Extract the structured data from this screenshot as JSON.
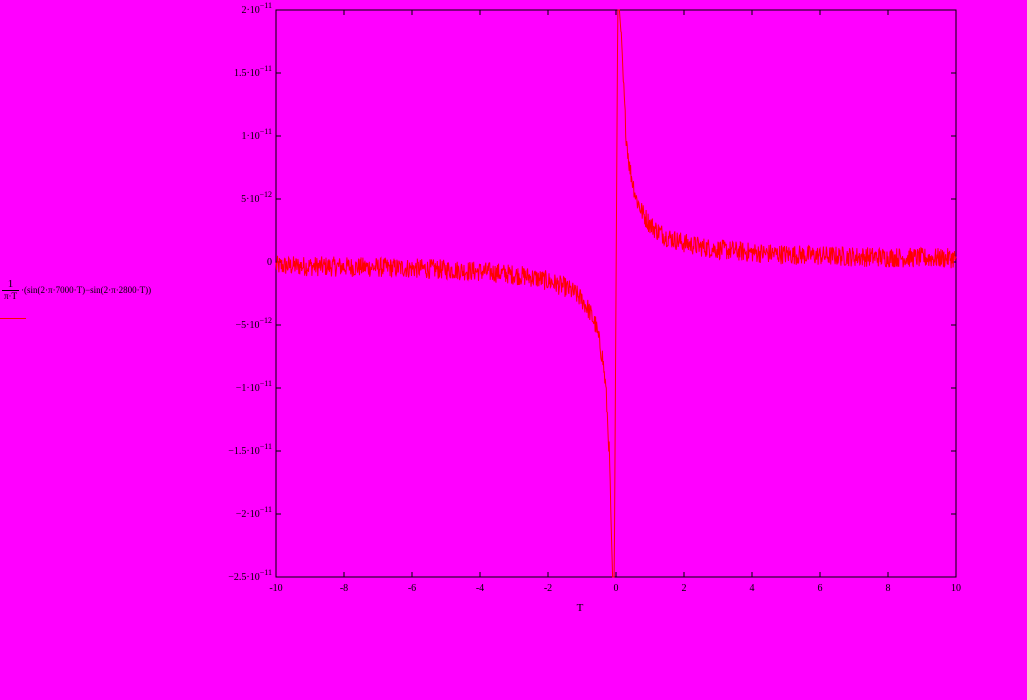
{
  "chart_data": {
    "type": "line",
    "xlabel": "T",
    "ylabel": {
      "numerator": "1",
      "denominator": "π·T",
      "expression": "·(sin(2·π·7000·T)−sin(2·π·2800·T))"
    },
    "xlim": [
      -10,
      10
    ],
    "ylim": [
      -2.5e-11,
      2e-11
    ],
    "x_ticks": [
      -10,
      -8,
      -6,
      -4,
      -2,
      0,
      2,
      4,
      6,
      8,
      10
    ],
    "x_tick_labels": [
      "-10",
      "-8",
      "-6",
      "-4",
      "-2",
      "0",
      "2",
      "4",
      "6",
      "8",
      "10"
    ],
    "y_ticks": [
      2e-11,
      1.5e-11,
      1e-11,
      5e-12,
      0,
      -5e-12,
      -1e-11,
      -1.5e-11,
      -2e-11,
      -2.5e-11
    ],
    "y_tick_labels": [
      {
        "mant": "2·10",
        "exp": "−11"
      },
      {
        "mant": "1.5·10",
        "exp": "−11"
      },
      {
        "mant": "1·10",
        "exp": "−11"
      },
      {
        "mant": "5·10",
        "exp": "−12"
      },
      {
        "mant": "0",
        "exp": ""
      },
      {
        "mant": "−5·10",
        "exp": "−12"
      },
      {
        "mant": "−1·10",
        "exp": "−11"
      },
      {
        "mant": "−1.5·10",
        "exp": "−11"
      },
      {
        "mant": "−2·10",
        "exp": "−11"
      },
      {
        "mant": "−2.5·10",
        "exp": "−11"
      }
    ],
    "grid": false,
    "series": [
      {
        "color": "#ff0000",
        "x": [
          -10,
          -9,
          -8,
          -7,
          -6,
          -5,
          -4,
          -3.5,
          -3,
          -2.5,
          -2,
          -1.5,
          -1.2,
          -1,
          -0.8,
          -0.6,
          -0.4,
          -0.3,
          -0.2,
          -0.15,
          -0.1,
          -0.05,
          0.05,
          0.1,
          0.15,
          0.2,
          0.3,
          0.4,
          0.6,
          0.8,
          1,
          1.2,
          1.5,
          2,
          2.5,
          3,
          4,
          5,
          6,
          7,
          8,
          9,
          10
        ],
        "y": [
          -3e-13,
          -3.3e-13,
          -3.8e-13,
          -4.3e-13,
          -5e-13,
          -6e-13,
          -7.5e-13,
          -8.6e-13,
          -1e-12,
          -1.2e-12,
          -1.5e-12,
          -2e-12,
          -2.5e-12,
          -3e-12,
          -3.8e-12,
          -5e-12,
          -7.5e-12,
          -1e-11,
          -1.5e-11,
          -2e-11,
          -2.5e-11,
          -2.5e-11,
          2e-11,
          2e-11,
          1.8e-11,
          1.5e-11,
          1e-11,
          7.5e-12,
          5e-12,
          3.8e-12,
          3e-12,
          2.5e-12,
          2e-12,
          1.5e-12,
          1.2e-12,
          1e-12,
          7.5e-13,
          6e-13,
          5e-13,
          4.3e-13,
          3.8e-13,
          3.3e-13,
          3e-13
        ],
        "noise_amplitude": 8e-13
      }
    ]
  }
}
